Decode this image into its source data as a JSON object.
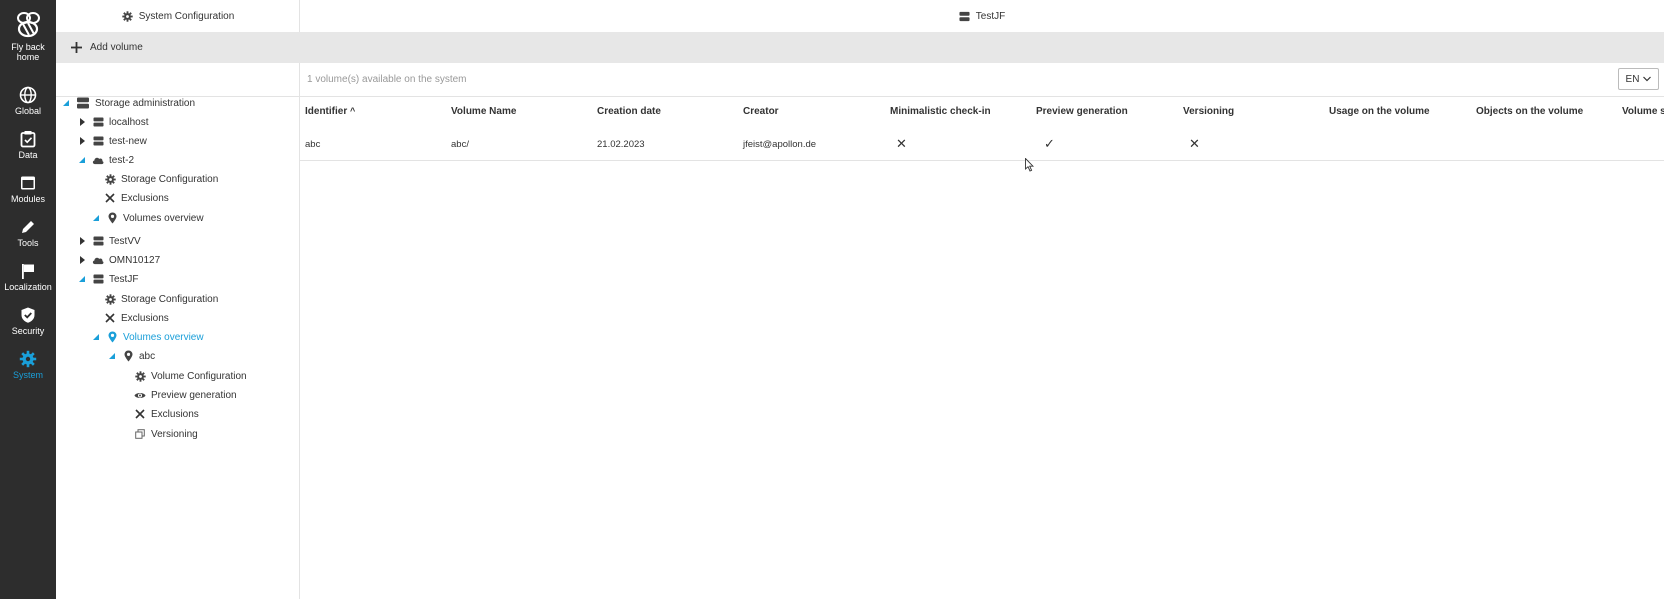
{
  "rail": {
    "items": [
      {
        "label": "Fly back home",
        "icon": "bee-logo-icon"
      },
      {
        "label": "Global",
        "icon": "globe-icon"
      },
      {
        "label": "Data",
        "icon": "clipboard-icon"
      },
      {
        "label": "Modules",
        "icon": "window-icon"
      },
      {
        "label": "Tools",
        "icon": "pencil-icon"
      },
      {
        "label": "Localization",
        "icon": "flag-icon"
      },
      {
        "label": "Security",
        "icon": "shield-icon"
      },
      {
        "label": "System",
        "icon": "gear-icon",
        "active": true
      }
    ],
    "fly_back_line1": "Fly back",
    "fly_back_line2": "home"
  },
  "left_panel": {
    "title": "System Configuration",
    "add_label": "Add volume",
    "tree": [
      {
        "label": "Storage administration",
        "icon": "server-icon",
        "expanded": true
      },
      {
        "label": "localhost",
        "icon": "server-icon",
        "expanded": false
      },
      {
        "label": "test-new",
        "icon": "server-icon",
        "expanded": false
      },
      {
        "label": "test-2",
        "icon": "cloud-icon",
        "expanded": true
      },
      {
        "label": "Storage Configuration",
        "icon": "gear-icon"
      },
      {
        "label": "Exclusions",
        "icon": "close-icon"
      },
      {
        "label": "Volumes overview",
        "icon": "location-pin-icon",
        "expanded": true
      },
      {
        "label": "TestVV",
        "icon": "server-icon",
        "expanded": false
      },
      {
        "label": "OMN10127",
        "icon": "cloud-icon",
        "expanded": false
      },
      {
        "label": "TestJF",
        "icon": "server-icon",
        "expanded": true
      },
      {
        "label": "Storage Configuration",
        "icon": "gear-icon"
      },
      {
        "label": "Exclusions",
        "icon": "close-icon"
      },
      {
        "label": "Volumes overview",
        "icon": "location-pin-icon",
        "expanded": true,
        "active": true
      },
      {
        "label": "abc",
        "icon": "location-pin-icon",
        "expanded": true
      },
      {
        "label": "Volume Configuration",
        "icon": "gear-icon"
      },
      {
        "label": "Preview generation",
        "icon": "eye-icon"
      },
      {
        "label": "Exclusions",
        "icon": "close-icon"
      },
      {
        "label": "Versioning",
        "icon": "copy-icon"
      }
    ]
  },
  "main": {
    "title": "TestJF",
    "available_text": "1 volume(s) available on the system",
    "language": "EN",
    "columns": [
      "Identifier",
      "Volume Name",
      "Creation date",
      "Creator",
      "Minimalistic check-in",
      "Preview generation",
      "Versioning",
      "Usage on the volume",
      "Objects on the volume",
      "Volume s"
    ],
    "sorted_column_indicator": "^",
    "rows": [
      {
        "identifier": "abc",
        "volume_name": "abc/",
        "creation_date": "21.02.2023",
        "creator": "jfeist@apollon.de",
        "minimalistic_checkin": "✕",
        "preview_generation": "✓",
        "versioning": "✕"
      }
    ]
  },
  "colors": {
    "accent": "#1a9fd9",
    "rail": "#2d2d2d",
    "graybar": "#e7e7e7"
  }
}
